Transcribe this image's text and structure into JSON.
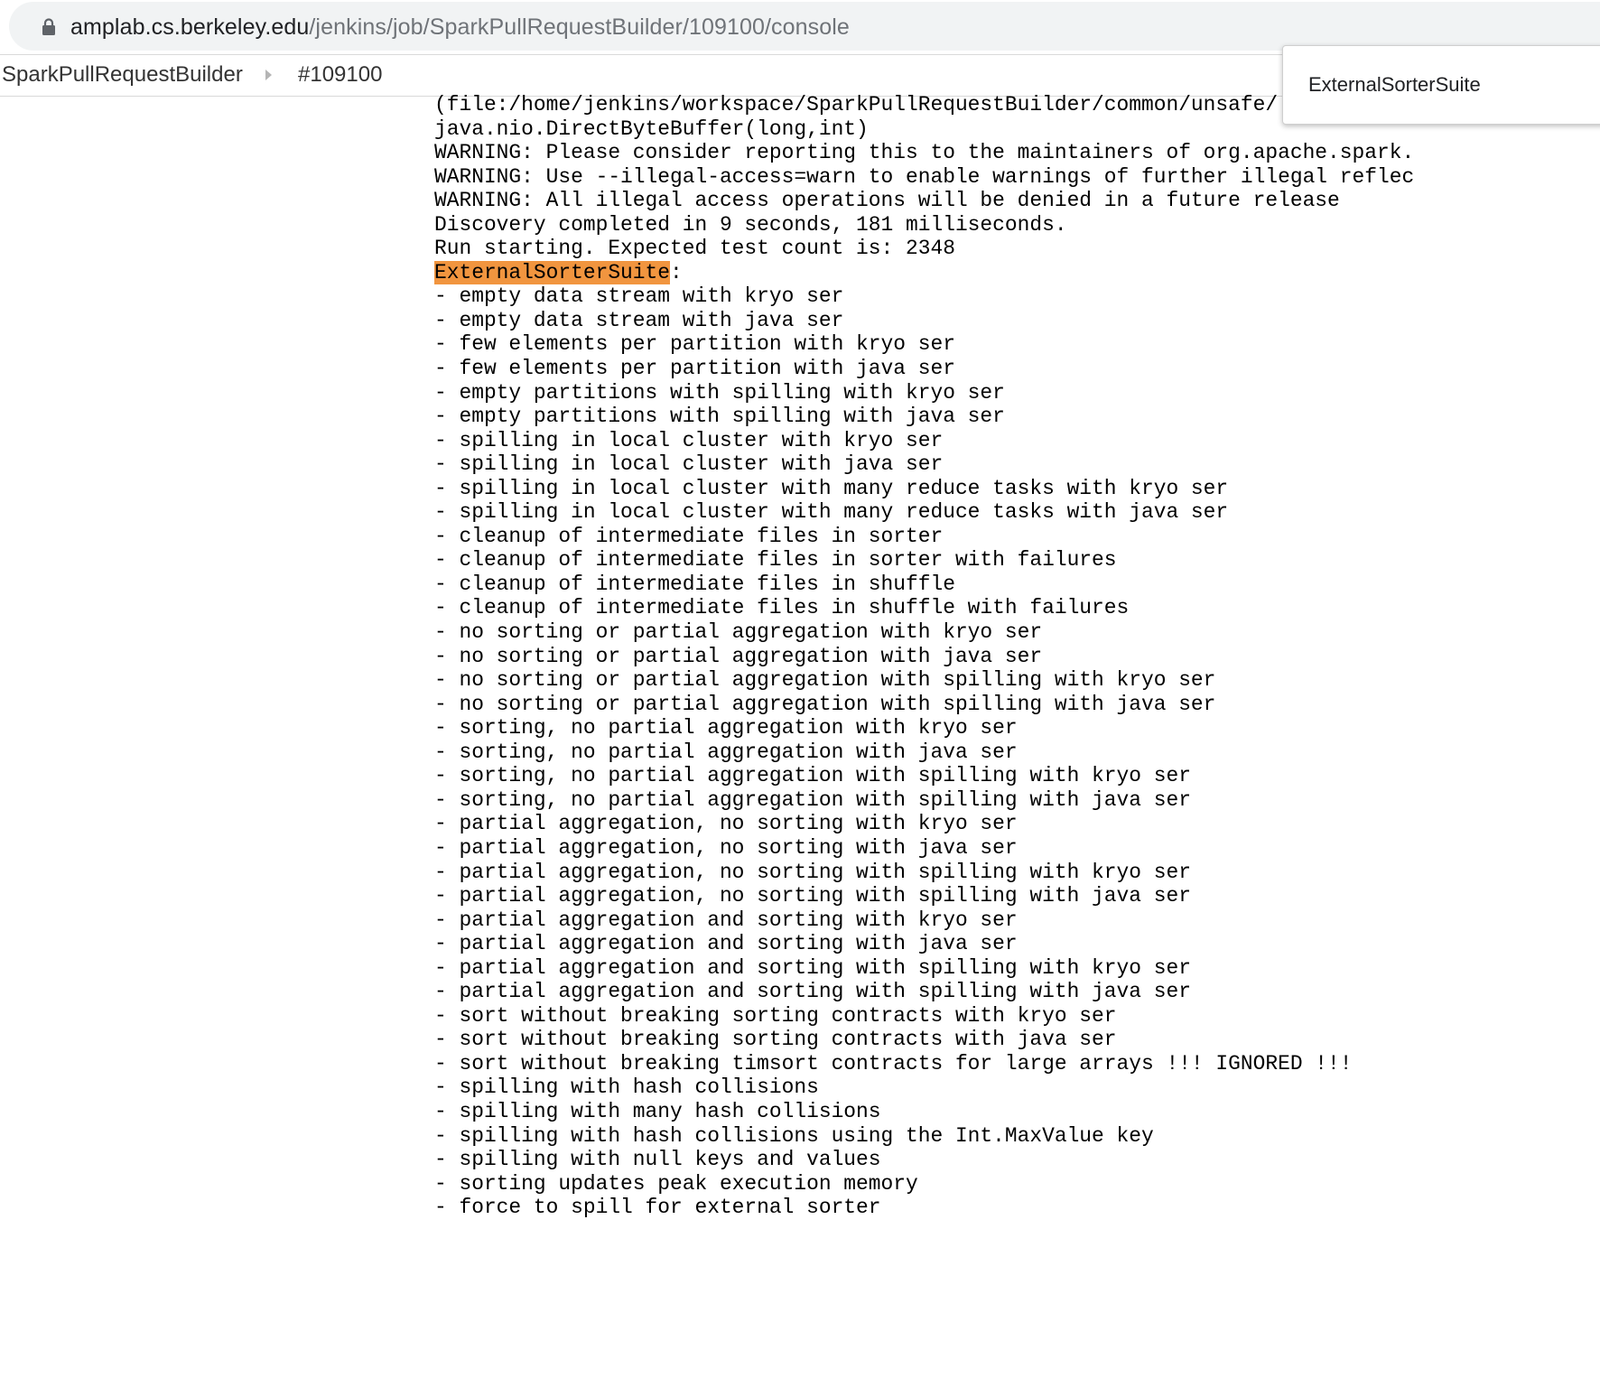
{
  "browser": {
    "url_host": "amplab.cs.berkeley.edu",
    "url_path": "/jenkins/job/SparkPullRequestBuilder/109100/console"
  },
  "breadcrumbs": {
    "job": "SparkPullRequestBuilder",
    "build": "#109100"
  },
  "find_bar": {
    "query": "ExternalSorterSuite"
  },
  "console": {
    "lines": [
      "(file:/home/jenkins/workspace/SparkPullRequestBuilder/common/unsafe/",
      "java.nio.DirectByteBuffer(long,int)",
      "WARNING: Please consider reporting this to the maintainers of org.apache.spark.",
      "WARNING: Use --illegal-access=warn to enable warnings of further illegal reflec",
      "WARNING: All illegal access operations will be denied in a future release",
      "Discovery completed in 9 seconds, 181 milliseconds.",
      "Run starting. Expected test count is: 2348",
      "ExternalSorterSuite:",
      "- empty data stream with kryo ser",
      "- empty data stream with java ser",
      "- few elements per partition with kryo ser",
      "- few elements per partition with java ser",
      "- empty partitions with spilling with kryo ser",
      "- empty partitions with spilling with java ser",
      "- spilling in local cluster with kryo ser",
      "- spilling in local cluster with java ser",
      "- spilling in local cluster with many reduce tasks with kryo ser",
      "- spilling in local cluster with many reduce tasks with java ser",
      "- cleanup of intermediate files in sorter",
      "- cleanup of intermediate files in sorter with failures",
      "- cleanup of intermediate files in shuffle",
      "- cleanup of intermediate files in shuffle with failures",
      "- no sorting or partial aggregation with kryo ser",
      "- no sorting or partial aggregation with java ser",
      "- no sorting or partial aggregation with spilling with kryo ser",
      "- no sorting or partial aggregation with spilling with java ser",
      "- sorting, no partial aggregation with kryo ser",
      "- sorting, no partial aggregation with java ser",
      "- sorting, no partial aggregation with spilling with kryo ser",
      "- sorting, no partial aggregation with spilling with java ser",
      "- partial aggregation, no sorting with kryo ser",
      "- partial aggregation, no sorting with java ser",
      "- partial aggregation, no sorting with spilling with kryo ser",
      "- partial aggregation, no sorting with spilling with java ser",
      "- partial aggregation and sorting with kryo ser",
      "- partial aggregation and sorting with java ser",
      "- partial aggregation and sorting with spilling with kryo ser",
      "- partial aggregation and sorting with spilling with java ser",
      "- sort without breaking sorting contracts with kryo ser",
      "- sort without breaking sorting contracts with java ser",
      "- sort without breaking timsort contracts for large arrays !!! IGNORED !!!",
      "- spilling with hash collisions",
      "- spilling with many hash collisions",
      "- spilling with hash collisions using the Int.MaxValue key",
      "- spilling with null keys and values",
      "- sorting updates peak execution memory",
      "- force to spill for external sorter"
    ],
    "highlight_color": "#f1953f"
  }
}
